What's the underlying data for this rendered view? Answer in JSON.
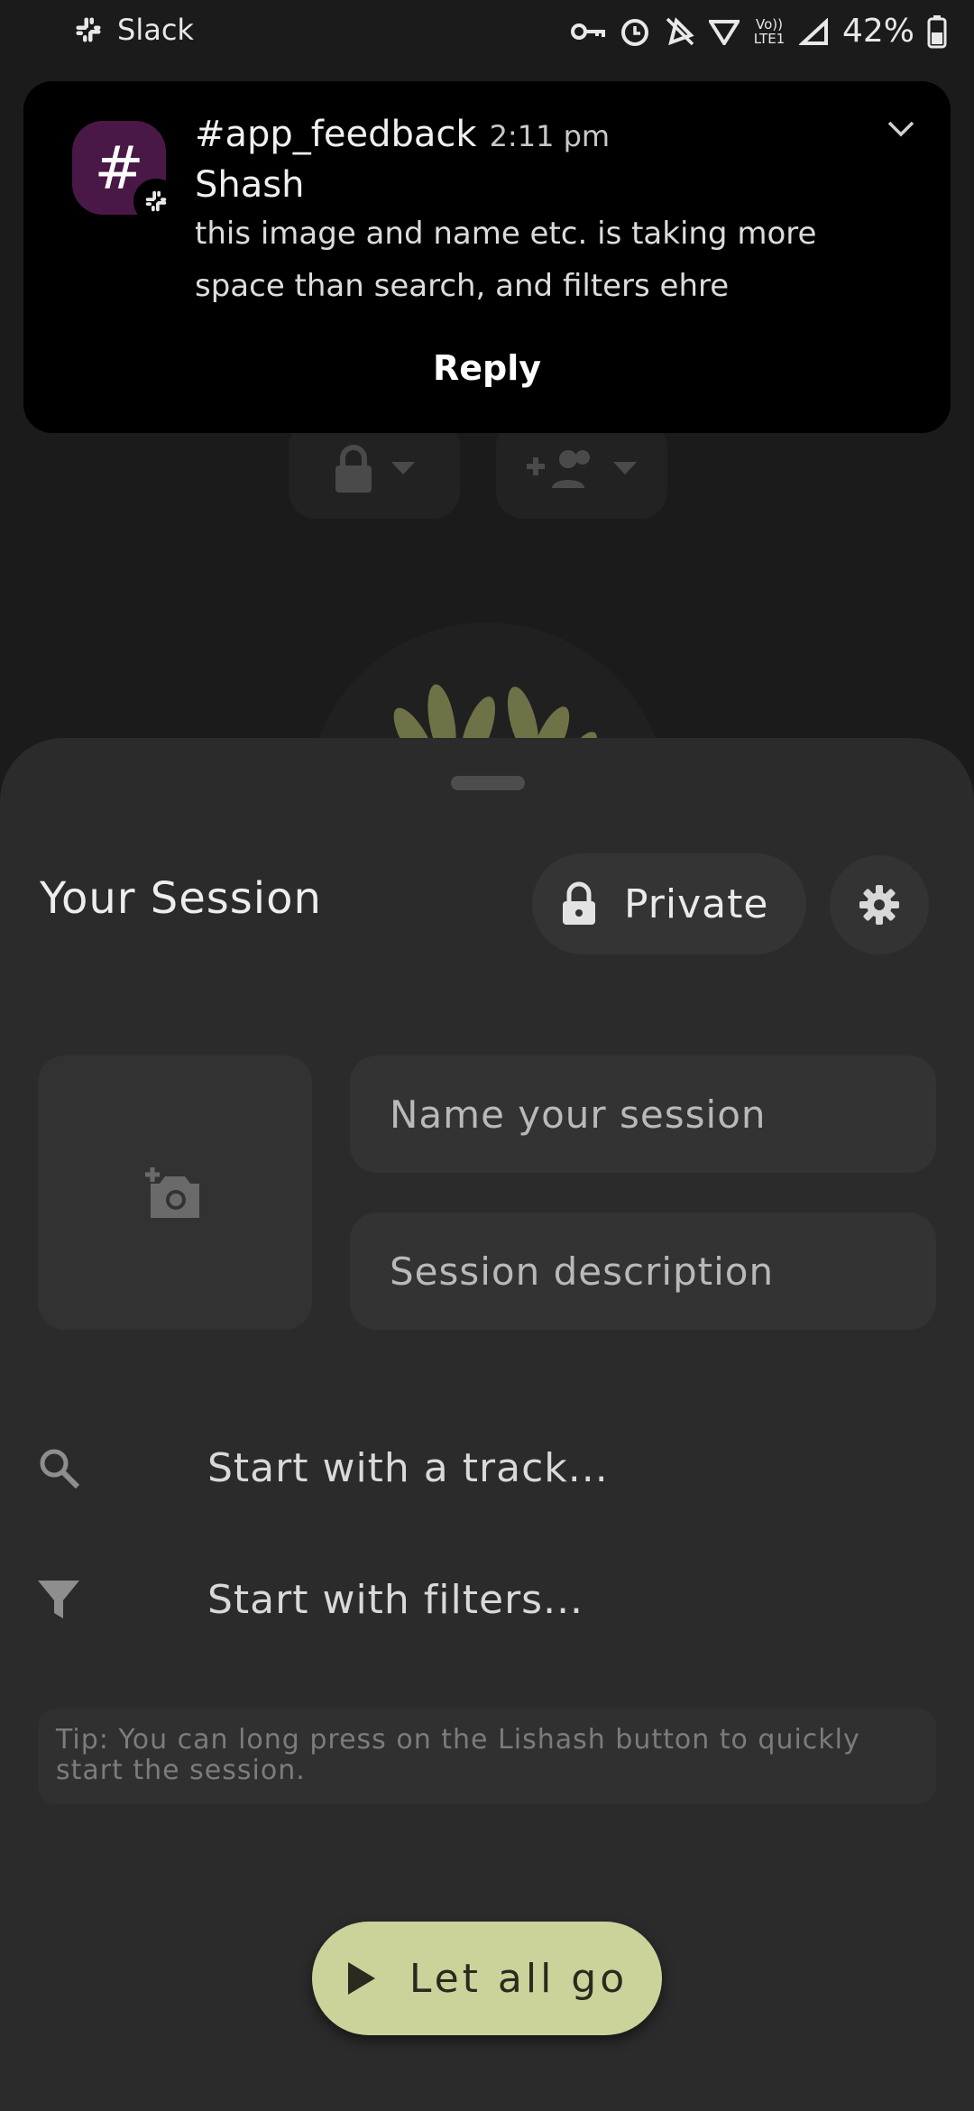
{
  "status_bar": {
    "app_name": "Slack",
    "battery": "42%",
    "icons": [
      "key-icon",
      "alarm-icon",
      "mute-icon",
      "wifi-icon",
      "volte-icon",
      "signal-icon",
      "battery-icon"
    ],
    "volte_label": "Vo)) LTE1"
  },
  "notification": {
    "channel": "#app_feedback",
    "time": "2:11 pm",
    "sender": "Shash",
    "message": "this image and name etc. is taking more space than search, and filters ehre",
    "action": "Reply",
    "channel_glyph": "#",
    "accent": "#4a1847"
  },
  "background_app": {
    "chip_icons": [
      "lock-icon",
      "add-group-icon"
    ]
  },
  "sheet": {
    "title": "Your Session",
    "private_label": "Private",
    "name_placeholder": "Name your session",
    "description_placeholder": "Session description",
    "track_option": "Start with a track...",
    "filters_option": "Start with filters...",
    "tip": "Tip: You can long press on the Lishash button to quickly start the session.",
    "go_button": "Let all go",
    "accent": "#cbd29a"
  }
}
